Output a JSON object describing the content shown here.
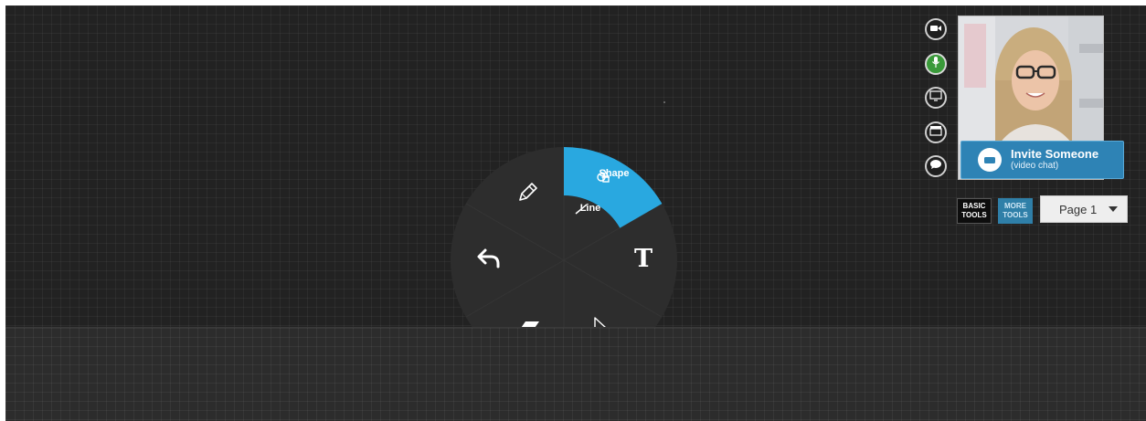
{
  "radial_menu": {
    "items": [
      {
        "id": "shape",
        "label": "Shape",
        "icon": "shapes-icon",
        "active": true
      },
      {
        "id": "line",
        "label": "Line",
        "icon": "line-icon",
        "active": false
      },
      {
        "id": "text",
        "icon": "text-tool-icon"
      },
      {
        "id": "select",
        "icon": "cursor-icon"
      },
      {
        "id": "eraser",
        "icon": "eraser-icon"
      },
      {
        "id": "undo",
        "icon": "undo-icon"
      },
      {
        "id": "pen",
        "icon": "pencil-icon"
      }
    ],
    "colors": {
      "active": "#29a8e0",
      "disc": "#2d2d2d"
    }
  },
  "side_buttons": [
    {
      "id": "video",
      "icon": "video-camera-icon",
      "active": false
    },
    {
      "id": "mic",
      "icon": "microphone-icon",
      "active": true
    },
    {
      "id": "screen",
      "icon": "screen-share-icon",
      "active": false
    },
    {
      "id": "clapper",
      "icon": "clapperboard-icon",
      "active": false
    },
    {
      "id": "chat",
      "icon": "chat-bubble-icon",
      "active": false
    }
  ],
  "video_chat": {
    "invite_title": "Invite Someone",
    "invite_subtitle": "(video chat)"
  },
  "toolbar": {
    "basic_tools": "BASIC\nTOOLS",
    "more_tools": "MORE\nTOOLS",
    "page_select": "Page 1"
  },
  "colors": {
    "canvas": "#222222",
    "accent": "#29a8e0",
    "invite": "#2e83b5",
    "mic_active": "#3a9a3a"
  }
}
